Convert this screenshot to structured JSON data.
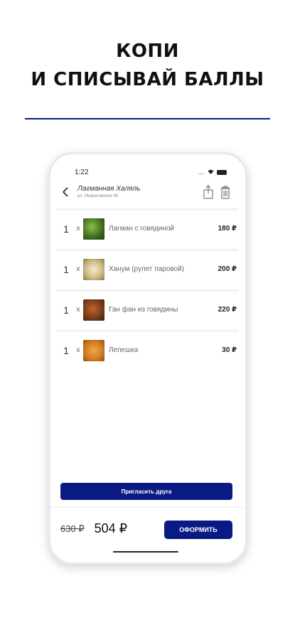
{
  "headline": {
    "line1": "КОПИ",
    "line2": "И СПИСЫВАЙ БАЛЛЫ"
  },
  "status_bar": {
    "time": "1:22",
    "dots": "....",
    "wifi": "⌔"
  },
  "header": {
    "venue_name": "Лагманная Халяль",
    "venue_address": "ул. Некрасовская 45"
  },
  "cart": {
    "items": [
      {
        "qty": "1",
        "times": "x",
        "name": "Лагман с говядиной",
        "price": "180 ₽",
        "image": "lagman-photo",
        "color": "#4f7a2e"
      },
      {
        "qty": "1",
        "times": "x",
        "name": "Ханум (рулет паровой)",
        "price": "200 ₽",
        "image": "khanum-photo",
        "color": "#d9c9a0"
      },
      {
        "qty": "1",
        "times": "x",
        "name": "Ган фан из говядины",
        "price": "220 ₽",
        "image": "ganfan-photo",
        "color": "#7a3e1c"
      },
      {
        "qty": "1",
        "times": "x",
        "name": "Лепешка",
        "price": "30 ₽",
        "image": "flatbread-photo",
        "color": "#d98a2e"
      }
    ]
  },
  "invite_button": {
    "label": "Пригласить друга"
  },
  "totals": {
    "old_price": "630 ₽",
    "new_price": "504 ₽"
  },
  "checkout_button": {
    "label": "ОФОРМИТЬ"
  },
  "colors": {
    "accent": "#0a1a85",
    "divider": "#0b1a8c"
  }
}
